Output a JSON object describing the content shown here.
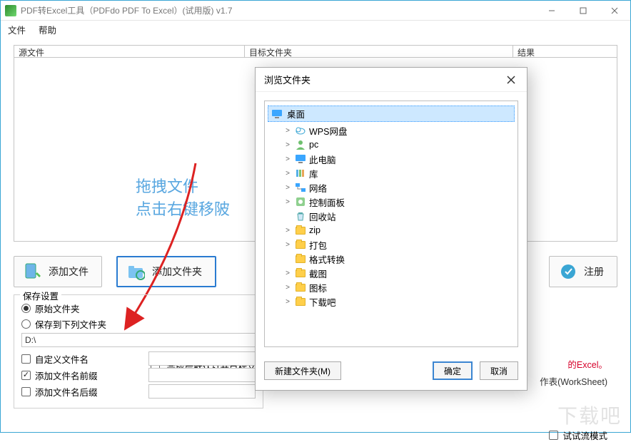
{
  "titlebar": {
    "title": "PDF转Excel工具（PDFdo PDF To Excel）(试用版) v1.7"
  },
  "menu": {
    "file": "文件",
    "help": "帮助"
  },
  "grid": {
    "col1": "源文件",
    "col2": "目标文件夹",
    "col3": "结果"
  },
  "dropzone": {
    "line1": "拖拽文件",
    "line2": "点击右键移陂"
  },
  "buttons": {
    "add_file": "添加文件",
    "add_folder": "添加文件夹",
    "register": "注册"
  },
  "option_after_done": "完成后默认打开目标文件",
  "save": {
    "legend": "保存设置",
    "orig": "原始文件夹",
    "tofolder": "保存到下列文件夹",
    "path": "D:\\",
    "customname": "自定义文件名",
    "prefix": "添加文件名前缀",
    "suffix": "添加文件名后缀"
  },
  "info": {
    "red": "的Excel。",
    "gray": "作表(WorkSheet)",
    "trymode": "试试流模式"
  },
  "dialog": {
    "title": "浏览文件夹",
    "selected": "桌面",
    "nodes": [
      {
        "expand": ">",
        "icon": "cloud",
        "label": "WPS网盘"
      },
      {
        "expand": ">",
        "icon": "user",
        "label": "pc"
      },
      {
        "expand": ">",
        "icon": "pc",
        "label": "此电脑"
      },
      {
        "expand": ">",
        "icon": "lib",
        "label": "库"
      },
      {
        "expand": ">",
        "icon": "net",
        "label": "网络"
      },
      {
        "expand": ">",
        "icon": "panel",
        "label": "控制面板"
      },
      {
        "expand": "",
        "icon": "recycle",
        "label": "回收站"
      },
      {
        "expand": ">",
        "icon": "folder",
        "label": "zip"
      },
      {
        "expand": ">",
        "icon": "folder",
        "label": "打包"
      },
      {
        "expand": "",
        "icon": "folder",
        "label": "格式转换"
      },
      {
        "expand": ">",
        "icon": "folder",
        "label": "截图"
      },
      {
        "expand": ">",
        "icon": "folder",
        "label": "图标"
      },
      {
        "expand": ">",
        "icon": "folder",
        "label": "下载吧"
      }
    ],
    "new_folder": "新建文件夹(M)",
    "ok": "确定",
    "cancel": "取消"
  },
  "watermark": "下载吧"
}
